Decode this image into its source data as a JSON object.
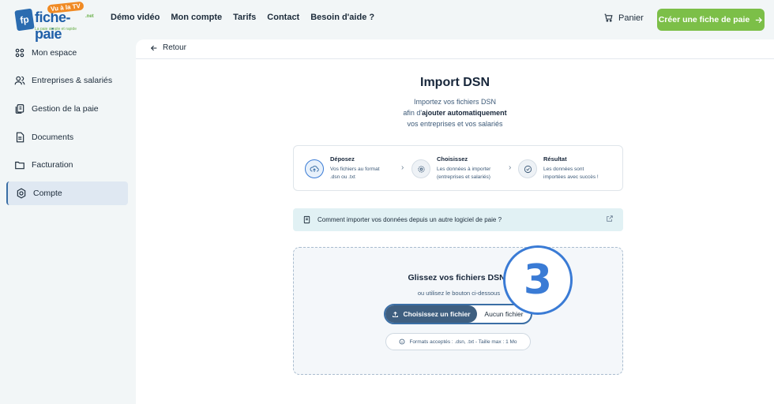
{
  "header": {
    "logo": {
      "badge": "Vu à la TV",
      "name": "fiche-paie",
      "suffix": ".net",
      "tagline": "La paie simple et rapide",
      "mark": "fp"
    },
    "nav": [
      "Démo vidéo",
      "Mon compte",
      "Tarifs",
      "Contact",
      "Besoin d'aide ?"
    ],
    "cart_label": "Panier",
    "cta_label": "Créer une fiche de paie"
  },
  "sidebar": {
    "items": [
      {
        "label": "Mon espace",
        "icon": "grid-icon"
      },
      {
        "label": "Entreprises & salariés",
        "icon": "users-icon"
      },
      {
        "label": "Gestion de la paie",
        "icon": "documents-icon"
      },
      {
        "label": "Documents",
        "icon": "file-icon"
      },
      {
        "label": "Facturation",
        "icon": "folder-icon"
      },
      {
        "label": "Compte",
        "icon": "gear-icon",
        "active": true
      }
    ]
  },
  "main": {
    "back_label": "Retour",
    "title": "Import DSN",
    "subtitle_line1": "Importez vos fichiers DSN",
    "subtitle_line2_pre": "afin d'",
    "subtitle_line2_bold": "ajouter automatiquement",
    "subtitle_line3": "vos entreprises et vos salariés",
    "steps": [
      {
        "title": "Déposez",
        "desc1": "Vos fichiers au format",
        "desc2": ".dsn ou .txt",
        "icon": "upload-cloud-icon"
      },
      {
        "title": "Choisissez",
        "desc1": "Les données à importer",
        "desc2": "(entreprises et salariés)",
        "icon": "settings-icon"
      },
      {
        "title": "Résultat",
        "desc1": "Les données sont",
        "desc2": "importées avec succès !",
        "icon": "check-circle-icon"
      }
    ],
    "info_text": "Comment importer vos données depuis un autre logiciel de paie ?",
    "drop": {
      "title": "Glissez vos fichiers DSN i",
      "sub": "ou utilisez le bouton ci-dessous",
      "choose_label": "Choisissez un fichier",
      "none_label": "Aucun fichier",
      "formats": "Formats acceptés : .dsn, .txt - Taille max : 1 Mo"
    },
    "step_badge": "3"
  },
  "colors": {
    "accent": "#3a7bd5",
    "cta": "#7cbf48",
    "info_bg": "#e1f1f4"
  }
}
